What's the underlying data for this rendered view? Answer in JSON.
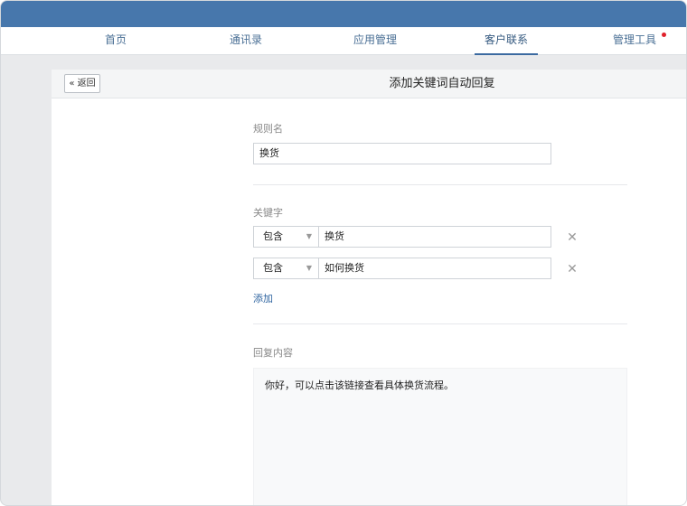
{
  "nav": {
    "tabs": [
      {
        "label": "首页",
        "active": false
      },
      {
        "label": "通讯录",
        "active": false
      },
      {
        "label": "应用管理",
        "active": false
      },
      {
        "label": "客户联系",
        "active": true
      },
      {
        "label": "管理工具",
        "active": false,
        "has_notification": true
      }
    ]
  },
  "header": {
    "back_label": "« 返回",
    "title": "添加关键词自动回复"
  },
  "form": {
    "rule_name": {
      "label": "规则名",
      "value": "换货"
    },
    "keywords": {
      "label": "关键字",
      "rows": [
        {
          "match": "包含",
          "value": "换货"
        },
        {
          "match": "包含",
          "value": "如何换货"
        }
      ],
      "add_label": "添加"
    },
    "reply": {
      "label": "回复内容",
      "value": "你好，可以点击该链接查看具体换货流程。"
    }
  },
  "colors": {
    "topbar": "#4777ac",
    "accent": "#3b6aa0",
    "notification": "#e0212b"
  },
  "icons": {
    "remove": "close-icon",
    "select_caret": "caret-down-icon",
    "back": "double-chevron-left-icon"
  }
}
